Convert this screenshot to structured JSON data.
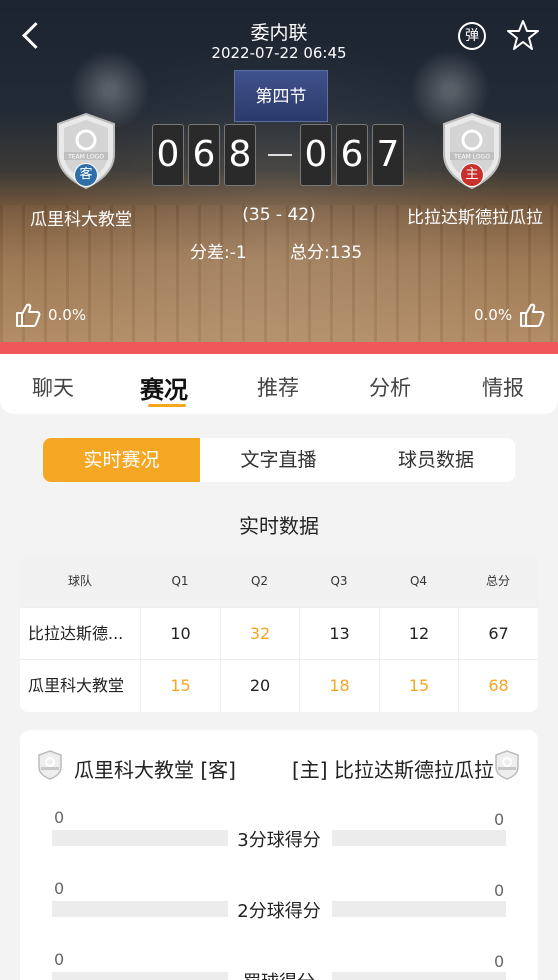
{
  "header": {
    "league": "委内联",
    "datetime": "2022-07-22 06:45",
    "danmu_label": "弹",
    "period": "第四节",
    "away": {
      "name": "瓜里科大教堂",
      "side_badge": "客",
      "score_digits": [
        "0",
        "6",
        "8"
      ],
      "like_pct": "0.0%"
    },
    "home": {
      "name": "比拉达斯德拉瓜拉",
      "side_badge": "主",
      "score_digits": [
        "0",
        "6",
        "7"
      ],
      "like_pct": "0.0%"
    },
    "half_score": "(35 - 42)",
    "spread": "分差:-1",
    "total": "总分:135",
    "logo_text": "TEAM LOGO"
  },
  "tabs": [
    "聊天",
    "赛况",
    "推荐",
    "分析",
    "情报"
  ],
  "active_tab": "赛况",
  "segments": [
    "实时赛况",
    "文字直播",
    "球员数据"
  ],
  "section_title": "实时数据",
  "table": {
    "headers": [
      "球队",
      "Q1",
      "Q2",
      "Q3",
      "Q4",
      "总分"
    ],
    "rows": [
      {
        "team": "比拉达斯德...",
        "cells": [
          "10",
          "32",
          "13",
          "12",
          "67"
        ]
      },
      {
        "team": "瓜里科大教堂",
        "cells": [
          "15",
          "20",
          "18",
          "15",
          "68"
        ]
      }
    ]
  },
  "stats": {
    "away_label": "瓜里科大教堂 [客]",
    "home_label": "[主] 比拉达斯德拉瓜拉",
    "rows": [
      {
        "label": "3分球得分",
        "left": "0",
        "right": "0"
      },
      {
        "label": "2分球得分",
        "left": "0",
        "right": "0"
      },
      {
        "label": "罚球得分",
        "left": "0",
        "right": "0"
      }
    ]
  },
  "colors": {
    "accent": "#f5a623",
    "red_bar": "#f0575a",
    "away_badge": "#2f6ea8",
    "home_badge": "#c7302b"
  }
}
